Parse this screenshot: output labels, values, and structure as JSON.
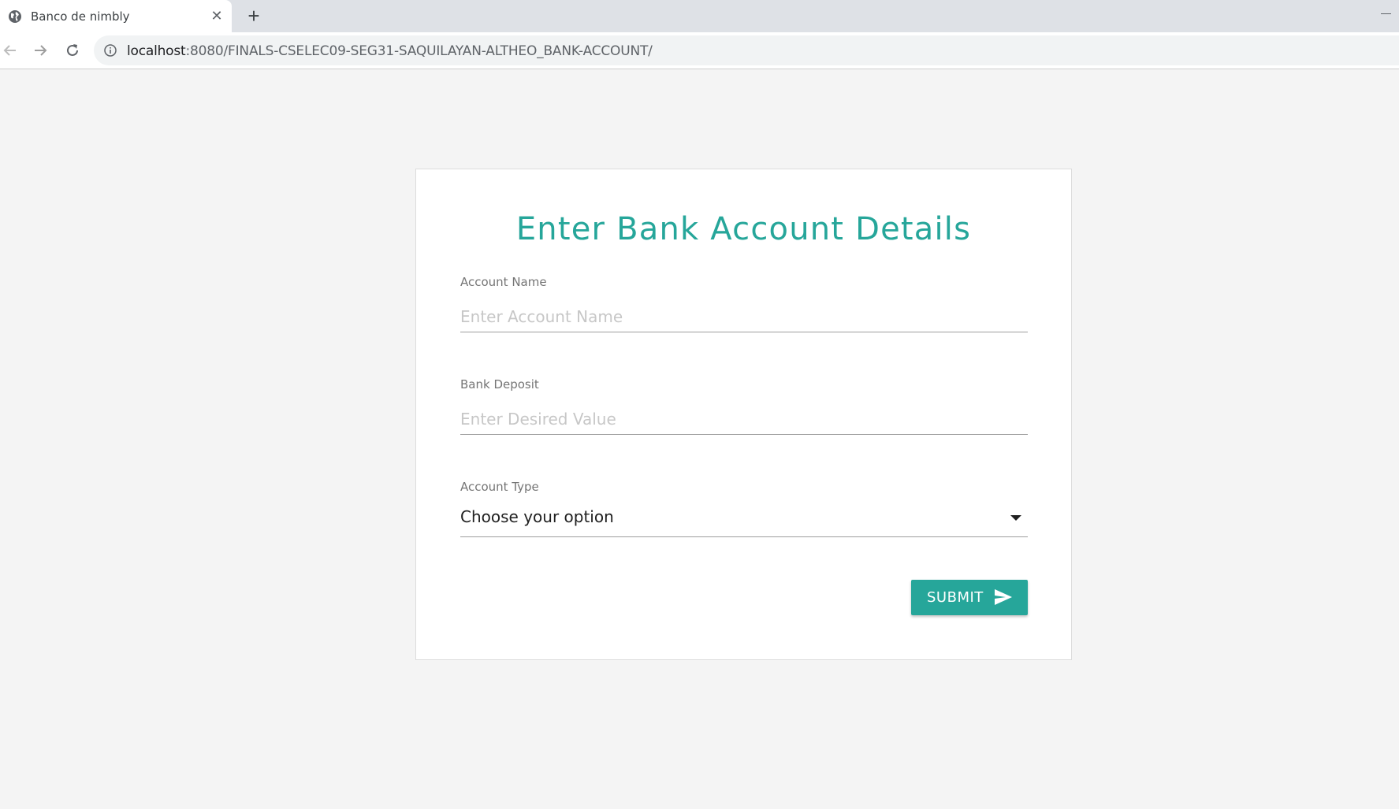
{
  "browser": {
    "tab_title": "Banco de nimbly",
    "tab_close": "✕",
    "new_tab": "+",
    "url_host": "localhost",
    "url_rest": ":8080/FINALS-CSELEC09-SEG31-SAQUILAYAN-ALTHEO_BANK-ACCOUNT/"
  },
  "form": {
    "heading": "Enter Bank Account Details",
    "account_name": {
      "label": "Account Name",
      "placeholder": "Enter Account Name",
      "value": ""
    },
    "bank_deposit": {
      "label": "Bank Deposit",
      "placeholder": "Enter Desired Value",
      "value": ""
    },
    "account_type": {
      "label": "Account Type",
      "selected": "Choose your option"
    },
    "submit_label": "SUBMIT"
  },
  "colors": {
    "accent": "#26a69a",
    "page_bg": "#f4f4f4",
    "card_bg": "#ffffff"
  },
  "icons": {
    "tab": "globe-icon",
    "back": "back-arrow-icon",
    "forward": "forward-arrow-icon",
    "reload": "reload-icon",
    "site_info": "info-icon",
    "select": "caret-down-icon",
    "submit": "send-icon"
  }
}
